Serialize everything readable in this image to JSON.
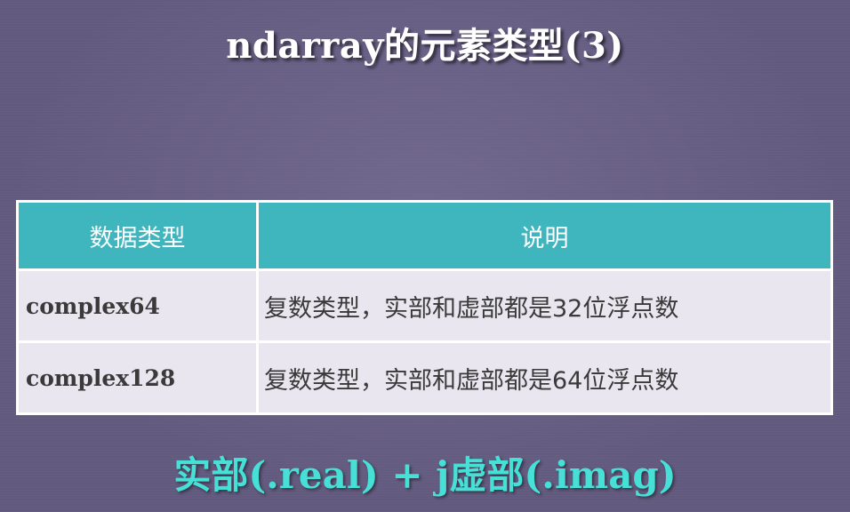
{
  "slide": {
    "title": "ndarray的元素类型(3)",
    "footer": "实部(.real) + j虚部(.imag)"
  },
  "table": {
    "headers": [
      "数据类型",
      "说明"
    ],
    "rows": [
      {
        "type": "complex64",
        "desc": "复数类型，实部和虚部都是32位浮点数"
      },
      {
        "type": "complex128",
        "desc": "复数类型，实部和虚部都是64位浮点数"
      }
    ]
  },
  "colors": {
    "background": "#625a7e",
    "header_fill": "#3fb5be",
    "cell_fill": "#e9e6ef",
    "footer_text": "#46e0d6"
  }
}
